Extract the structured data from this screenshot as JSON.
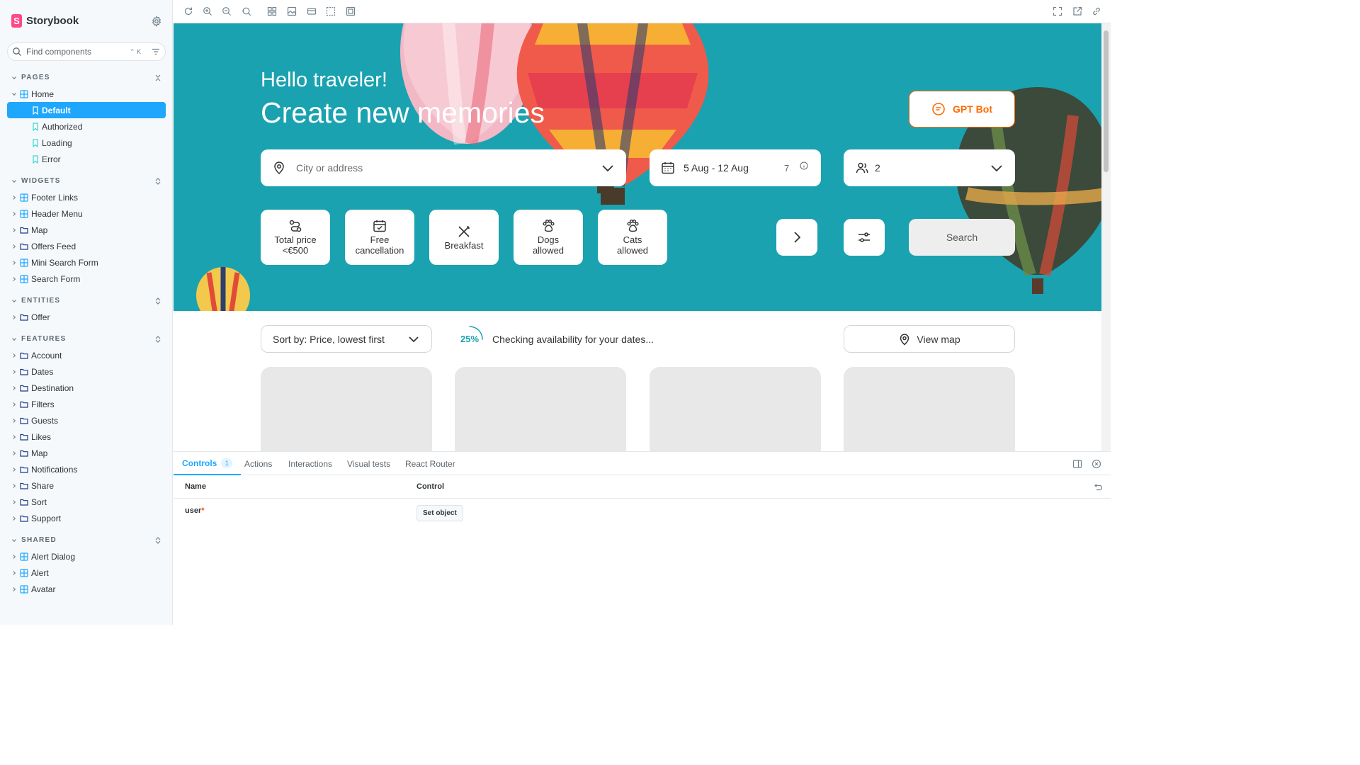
{
  "sidebar": {
    "brand": "Storybook",
    "search": {
      "placeholder": "Find components",
      "shortcut": "⌃ K"
    },
    "sections": {
      "pages": {
        "label": "PAGES",
        "home": "Home",
        "stories": [
          "Default",
          "Authorized",
          "Loading",
          "Error"
        ]
      },
      "widgets": {
        "label": "WIDGETS",
        "items": [
          "Footer Links",
          "Header Menu",
          "Map",
          "Offers Feed",
          "Mini Search Form",
          "Search Form"
        ]
      },
      "entities": {
        "label": "ENTITIES",
        "items": [
          "Offer"
        ]
      },
      "features": {
        "label": "FEATURES",
        "items": [
          "Account",
          "Dates",
          "Destination",
          "Filters",
          "Guests",
          "Likes",
          "Map",
          "Notifications",
          "Share",
          "Sort",
          "Support"
        ]
      },
      "shared": {
        "label": "SHARED",
        "items": [
          "Alert Dialog",
          "Alert",
          "Avatar"
        ]
      }
    }
  },
  "preview": {
    "hero": {
      "greeting": "Hello traveler!",
      "headline": "Create new memories",
      "gpt_button": "GPT Bot",
      "city_placeholder": "City or address",
      "dates": "5 Aug - 12 Aug",
      "nights": "7",
      "guests": "2",
      "chips": {
        "price": [
          "Total price",
          "<€500"
        ],
        "cancel": [
          "Free",
          "cancellation"
        ],
        "breakfast": [
          "Breakfast"
        ],
        "dogs": [
          "Dogs",
          "allowed"
        ],
        "cats": [
          "Cats",
          "allowed"
        ]
      },
      "search_button": "Search"
    },
    "results": {
      "sort_label": "Sort by: Price, lowest first",
      "progress_percent": "25%",
      "progress_value": 0.25,
      "progress_message": "Checking availability for your dates...",
      "map_button": "View map"
    },
    "colors": {
      "hero_bg": "#1aa2b0",
      "accent": "#ff6a00",
      "storybook_blue": "#1ea7fd"
    }
  },
  "panel": {
    "tabs": {
      "controls": "Controls",
      "controls_count": "1",
      "actions": "Actions",
      "interactions": "Interactions",
      "visual_tests": "Visual tests",
      "react_router": "React Router"
    },
    "table": {
      "col_name": "Name",
      "col_control": "Control",
      "row_name": "user",
      "required_mark": "*",
      "row_control": "Set object"
    }
  }
}
